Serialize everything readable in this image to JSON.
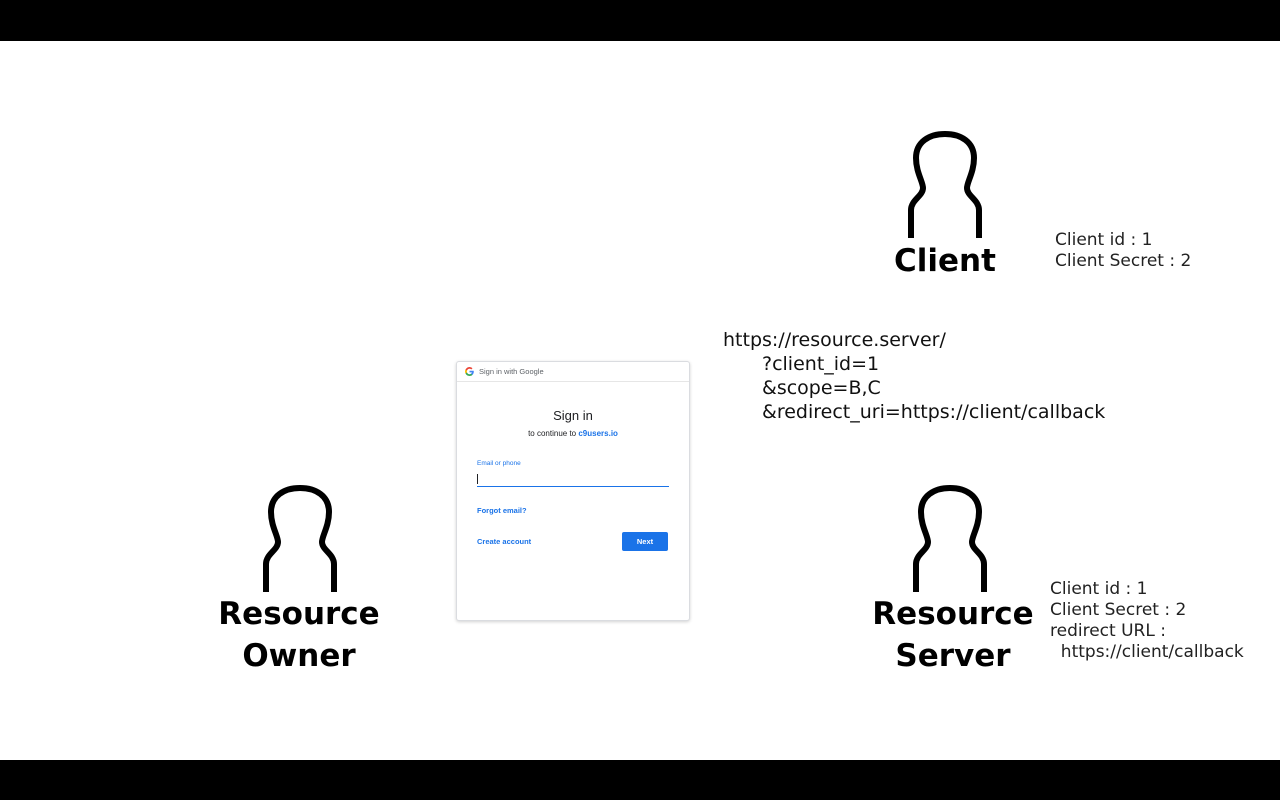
{
  "actors": {
    "client": {
      "label": "Client"
    },
    "resource_owner": {
      "label_line1": "Resource",
      "label_line2": "Owner"
    },
    "resource_server": {
      "label_line1": "Resource",
      "label_line2": "Server"
    }
  },
  "client_info": {
    "line1": "Client id : 1",
    "line2": "Client Secret : 2"
  },
  "server_info": {
    "line1": "Client id : 1",
    "line2": "Client Secret : 2",
    "line3": "redirect URL :",
    "line4": "  https://client/callback"
  },
  "auth_url": {
    "base": "https://resource.server/",
    "param1": "?client_id=1",
    "param2": "&scope=B,C",
    "param3": "&redirect_uri=https://client/callback"
  },
  "signin_card": {
    "header": "Sign in with Google",
    "title": "Sign in",
    "subtitle_prefix": "to continue to ",
    "subtitle_link": "c9users.io",
    "email_label": "Email or phone",
    "email_value": "",
    "forgot_label": "Forgot email?",
    "create_label": "Create account",
    "next_label": "Next"
  },
  "colors": {
    "google_blue": "#1a73e8",
    "icon_stroke": "#000000"
  }
}
